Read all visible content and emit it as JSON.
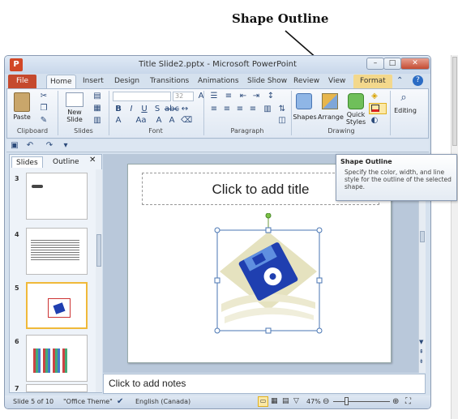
{
  "callout": {
    "label": "Shape Outline"
  },
  "window": {
    "title": "Title Slide2.pptx - Microsoft PowerPoint",
    "app_icon": "P"
  },
  "tabs": [
    "File",
    "Home",
    "Insert",
    "Design",
    "Transitions",
    "Animations",
    "Slide Show",
    "Review",
    "View",
    "Format"
  ],
  "ribbon": {
    "clipboard": {
      "paste": "Paste",
      "label": "Clipboard"
    },
    "slides": {
      "new_slide": "New Slide",
      "label": "Slides"
    },
    "font": {
      "size": "32",
      "label": "Font"
    },
    "paragraph": {
      "label": "Paragraph"
    },
    "drawing": {
      "shapes": "Shapes",
      "arrange": "Arrange",
      "quick_styles": "Quick Styles",
      "label": "Drawing"
    },
    "editing": {
      "label": "Editing"
    }
  },
  "panel_tabs": [
    "Slides",
    "Outline"
  ],
  "thumbnails": [
    {
      "num": "3"
    },
    {
      "num": "4"
    },
    {
      "num": "5"
    },
    {
      "num": "6"
    },
    {
      "num": "7"
    }
  ],
  "slide": {
    "title_placeholder": "Click to add title"
  },
  "notes": {
    "placeholder": "Click to add notes"
  },
  "status": {
    "slide_info": "Slide 5 of 10",
    "theme": "\"Office Theme\"",
    "language": "English (Canada)",
    "zoom": "47%"
  },
  "tooltip": {
    "title": "Shape Outline",
    "description": "Specify the color, width, and line style for the outline of the selected shape."
  },
  "colors": {
    "file_tab": "#c5492d",
    "format_tab": "#f3d88c",
    "floppy": "#1f3fb0",
    "tooltip_border": "#8a9bb3"
  }
}
